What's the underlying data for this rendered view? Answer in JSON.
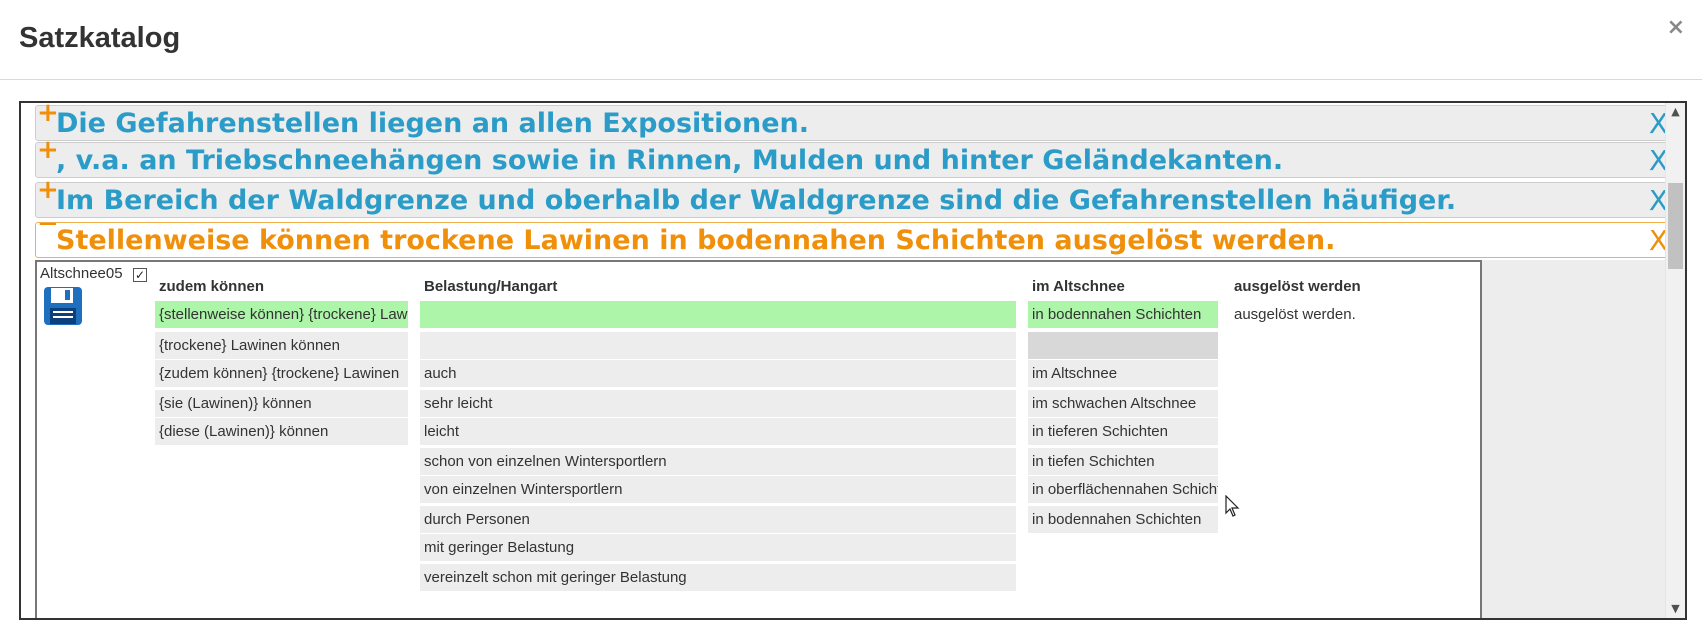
{
  "dialog": {
    "title": "Satzkatalog",
    "close_label": "×"
  },
  "sentences": [
    {
      "sign": "+",
      "text": "Die Gefahrenstellen liegen an allen Expositionen.",
      "remove": "X"
    },
    {
      "sign": "+",
      "text": ", v.a. an Triebschneehängen sowie in Rinnen, Mulden und hinter Geländekanten.",
      "remove": "X"
    },
    {
      "sign": "+",
      "text": "Im Bereich der Waldgrenze und oberhalb der Waldgrenze sind die Gefahrenstellen häufiger.",
      "remove": "X"
    },
    {
      "sign": "−",
      "text": "Stellenweise können trockene Lawinen in bodennahen Schichten ausgelöst werden.",
      "remove": "X"
    }
  ],
  "editor": {
    "name": "Altschnee05",
    "checkbox_checked": true,
    "columns": [
      {
        "header": "zudem können",
        "options": [
          "{stellenweise können} {trockene} Lawinen",
          "{trockene} Lawinen können",
          "{zudem können} {trockene} Lawinen",
          "{sie (Lawinen)} können",
          "{diese (Lawinen)} können"
        ]
      },
      {
        "header": "Belastung/Hangart",
        "options": [
          "",
          "",
          "auch",
          "sehr leicht",
          "leicht",
          "schon von einzelnen Wintersportlern",
          "von einzelnen Wintersportlern",
          "durch Personen",
          "mit geringer Belastung",
          "vereinzelt schon mit geringer Belastung"
        ]
      },
      {
        "header": "im Altschnee",
        "options": [
          "in bodennahen Schichten",
          "",
          "im Altschnee",
          "im schwachen Altschnee",
          "in tieferen Schichten",
          "in tiefen Schichten",
          "in oberflächennahen Schichten",
          "in bodennahen Schichten"
        ]
      },
      {
        "header": "ausgelöst werden",
        "options": [
          "ausgelöst werden."
        ]
      }
    ]
  },
  "colors": {
    "accent_blue": "#2b9cc8",
    "accent_orange": "#f0900a",
    "selected_green": "#adf5a9"
  },
  "icons": {
    "close": "close-icon",
    "save": "floppy-disk-icon",
    "check": "checkbox-icon",
    "cursor": "mouse-cursor-icon"
  }
}
